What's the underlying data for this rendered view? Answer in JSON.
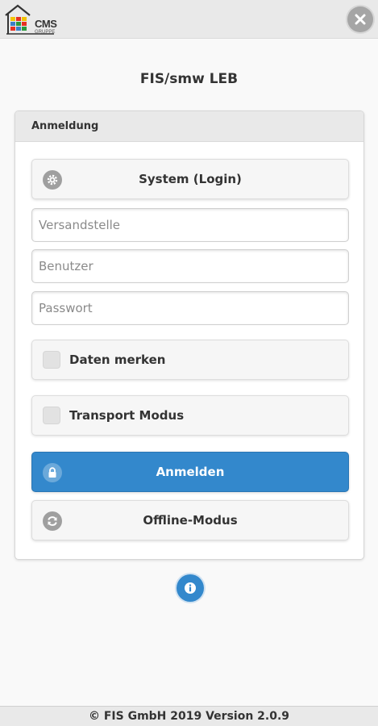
{
  "header": {
    "logo_text": "CMS",
    "logo_subtext": "GRUPPE",
    "close_icon": "close-icon"
  },
  "app_title": "FIS/smw LEB",
  "panel": {
    "title": "Anmeldung",
    "system_button": {
      "label": "System (Login)",
      "icon": "gear-icon"
    },
    "fields": {
      "versandstelle": {
        "placeholder": "Versandstelle",
        "value": ""
      },
      "benutzer": {
        "placeholder": "Benutzer",
        "value": ""
      },
      "passwort": {
        "placeholder": "Passwort",
        "value": ""
      }
    },
    "checkboxes": {
      "daten_merken": {
        "label": "Daten merken",
        "checked": false
      },
      "transport_modus": {
        "label": "Transport Modus",
        "checked": false
      }
    },
    "login_button": {
      "label": "Anmelden",
      "icon": "lock-icon"
    },
    "offline_button": {
      "label": "Offline-Modus",
      "icon": "refresh-icon"
    }
  },
  "info_icon": "info-icon",
  "footer": {
    "text": "© FIS GmbH 2019 Version 2.0.9"
  },
  "colors": {
    "accent": "#3388cc",
    "header_bg": "#e9e9e9",
    "page_bg": "#f9f9f9"
  }
}
